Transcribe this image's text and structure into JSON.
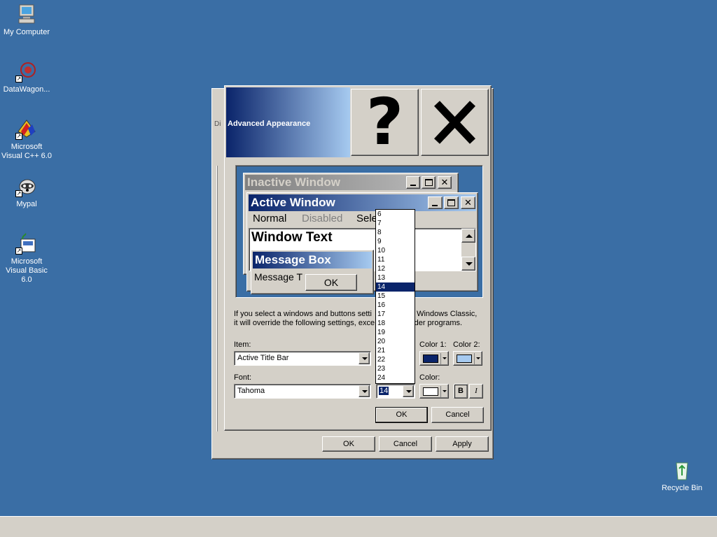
{
  "desktop": {
    "icons": [
      {
        "label": "My Computer",
        "icon": "my-computer-icon"
      },
      {
        "label": "DataWagon...",
        "icon": "datawagon-icon"
      },
      {
        "label": "Microsoft Visual C++ 6.0",
        "icon": "visual-cpp-icon"
      },
      {
        "label": "Mypal",
        "icon": "mypal-icon"
      },
      {
        "label": "Microsoft Visual Basic 6.0",
        "icon": "visual-basic-icon"
      },
      {
        "label": "Recycle Bin",
        "icon": "recycle-bin-icon"
      }
    ]
  },
  "back_dialog": {
    "partial_title": "Di",
    "ok_label": "OK",
    "cancel_label": "Cancel",
    "apply_label": "Apply"
  },
  "dialog": {
    "title": "Advanced Appearance",
    "help_glyph": "?",
    "close_glyph": "✕",
    "preview": {
      "inactive_title": "Inactive Window",
      "active_title": "Active Window",
      "menu_normal": "Normal",
      "menu_disabled": "Disabled",
      "menu_selected": "Sele",
      "window_text": "Window Text",
      "message_box_title": "Message Box",
      "message_text": "Message T",
      "ok_label": "OK"
    },
    "info_line1": "If you select a windows and buttons setti",
    "info_line1_end": "n Windows Classic,",
    "info_line2": "it will override the following settings, exce",
    "info_line2_end": "lder programs.",
    "item_label": "Item:",
    "item_value": "Active Title Bar",
    "color1_label": "Color 1:",
    "color2_label": "Color 2:",
    "color1_value": "#0a246a",
    "color2_value": "#a6caf0",
    "font_label": "Font:",
    "font_value": "Tahoma",
    "size_value": "14",
    "font_color_label": "Color:",
    "font_color_value": "#ffffff",
    "bold_label": "B",
    "italic_label": "I",
    "ok_label": "OK",
    "cancel_label": "Cancel"
  },
  "size_dropdown": {
    "options": [
      "6",
      "7",
      "8",
      "9",
      "10",
      "11",
      "12",
      "13",
      "14",
      "15",
      "16",
      "17",
      "18",
      "19",
      "20",
      "21",
      "22",
      "23",
      "24"
    ],
    "selected": "14"
  },
  "colors": {
    "desktop": "#3a6ea5",
    "active_title_start": "#0a246a",
    "active_title_end": "#a6caf0",
    "inactive_title": "#808080"
  }
}
